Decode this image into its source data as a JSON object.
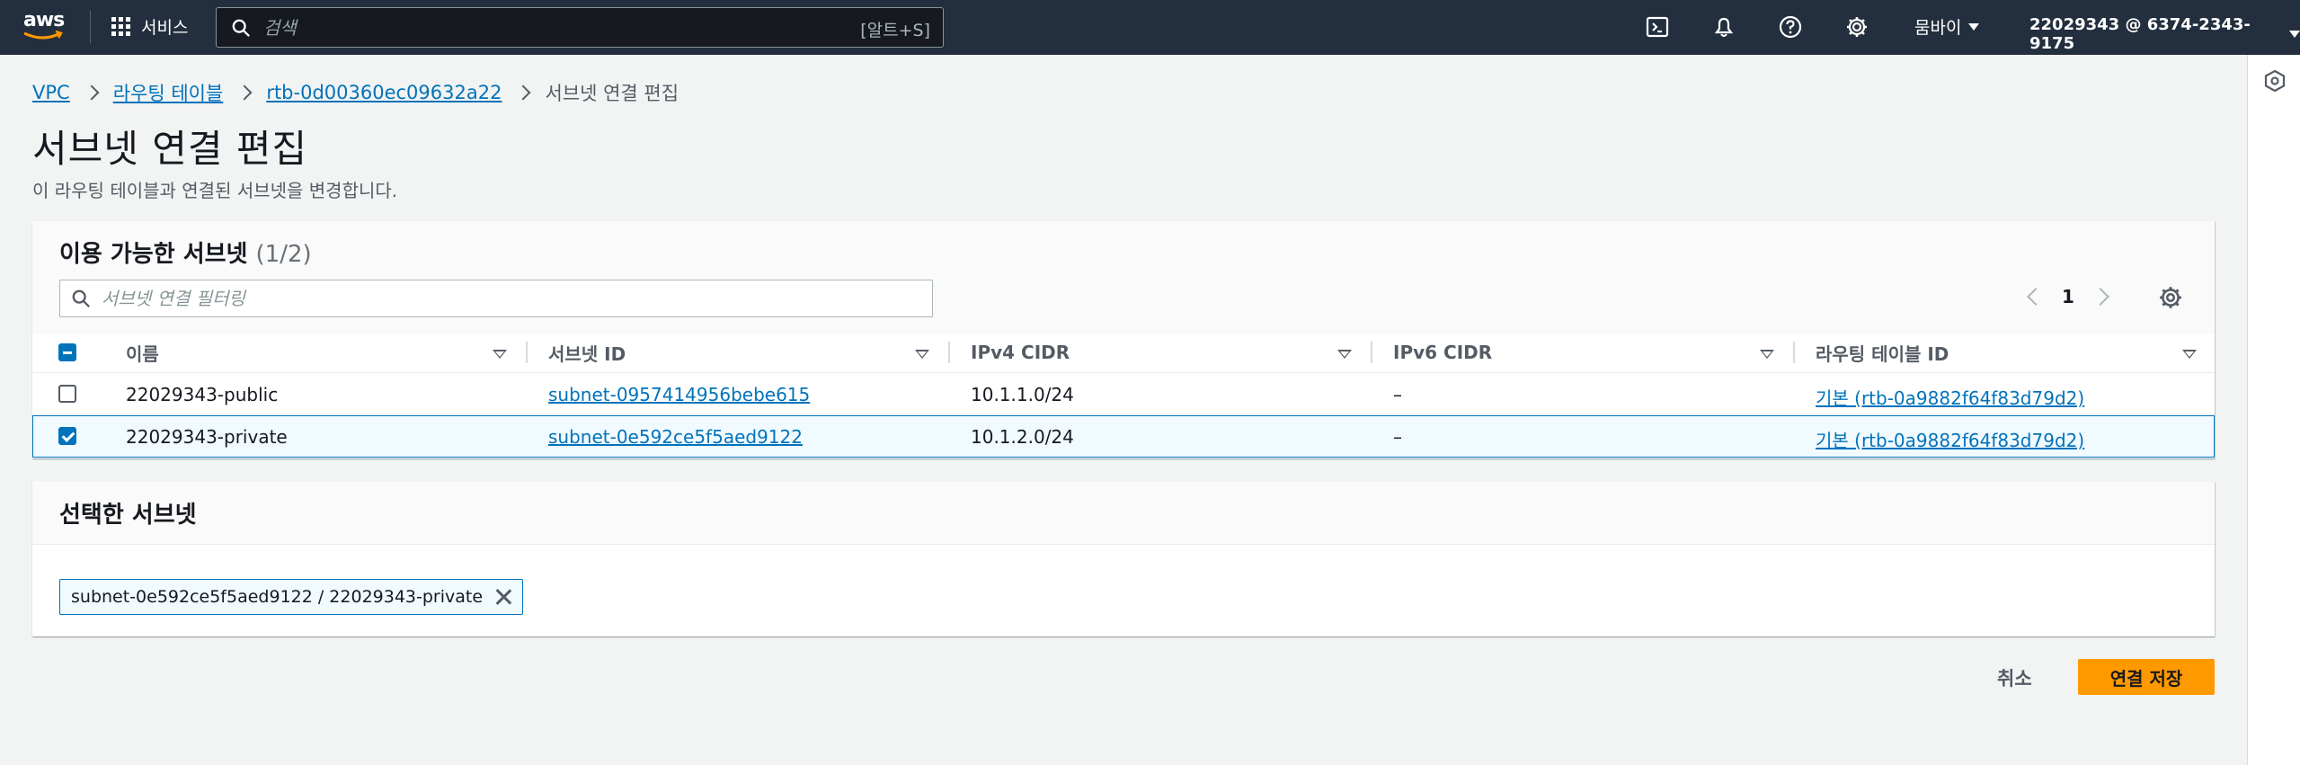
{
  "nav": {
    "logo_text": "aws",
    "services_label": "서비스",
    "search_placeholder": "검색",
    "search_shortcut": "[알트+S]",
    "region_label": "뭄바이",
    "account_label": "22029343 @ 6374-2343-9175"
  },
  "breadcrumb": {
    "items": [
      "VPC",
      "라우팅 테이블",
      "rtb-0d00360ec09632a22"
    ],
    "current": "서브넷 연결 편집"
  },
  "page": {
    "title": "서브넷 연결 편집",
    "description": "이 라우팅 테이블과 연결된 서브넷을 변경합니다."
  },
  "available": {
    "title": "이용 가능한 서브넷",
    "count": "(1/2)",
    "filter_placeholder": "서브넷 연결 필터링",
    "page_number": "1",
    "columns": [
      "이름",
      "서브넷 ID",
      "IPv4 CIDR",
      "IPv6 CIDR",
      "라우팅 테이블 ID"
    ],
    "rows": [
      {
        "name": "22029343-public",
        "subnet_id": "subnet-0957414956bebe615",
        "ipv4": "10.1.1.0/24",
        "ipv6": "–",
        "route_table": "기본 (rtb-0a9882f64f83d79d2)",
        "checked": false
      },
      {
        "name": "22029343-private",
        "subnet_id": "subnet-0e592ce5f5aed9122",
        "ipv4": "10.1.2.0/24",
        "ipv6": "–",
        "route_table": "기본 (rtb-0a9882f64f83d79d2)",
        "checked": true
      }
    ]
  },
  "selected": {
    "title": "선택한 서브넷",
    "token": "subnet-0e592ce5f5aed9122 / 22029343-private"
  },
  "actions": {
    "cancel_label": "취소",
    "save_label": "연결 저장"
  },
  "colors": {
    "nav_bg": "#232f3e",
    "link": "#0073bb",
    "primary_button": "#ff9900"
  }
}
